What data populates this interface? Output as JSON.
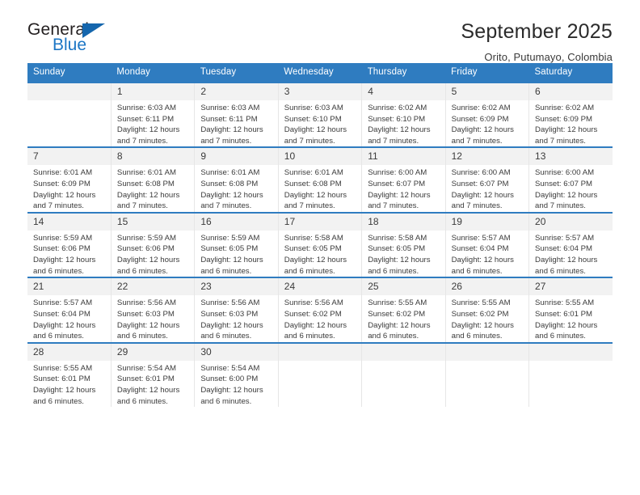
{
  "brand": {
    "name_top": "General",
    "name_bottom": "Blue",
    "triangle_color": "#1566ad",
    "blue_color": "#1c76c5"
  },
  "header": {
    "title": "September 2025",
    "location": "Orito, Putumayo, Colombia"
  },
  "theme": {
    "header_blue": "#2f7cc0",
    "daynum_bg": "#f2f2f2",
    "text": "#3b3b3b"
  },
  "weekday_headers": [
    "Sunday",
    "Monday",
    "Tuesday",
    "Wednesday",
    "Thursday",
    "Friday",
    "Saturday"
  ],
  "calendar": {
    "month": "September",
    "year": "2025",
    "weeks": [
      [
        {
          "day": ""
        },
        {
          "day": "1",
          "sunrise": "Sunrise: 6:03 AM",
          "sunset": "Sunset: 6:11 PM",
          "daylight_1": "Daylight: 12 hours",
          "daylight_2": "and 7 minutes."
        },
        {
          "day": "2",
          "sunrise": "Sunrise: 6:03 AM",
          "sunset": "Sunset: 6:11 PM",
          "daylight_1": "Daylight: 12 hours",
          "daylight_2": "and 7 minutes."
        },
        {
          "day": "3",
          "sunrise": "Sunrise: 6:03 AM",
          "sunset": "Sunset: 6:10 PM",
          "daylight_1": "Daylight: 12 hours",
          "daylight_2": "and 7 minutes."
        },
        {
          "day": "4",
          "sunrise": "Sunrise: 6:02 AM",
          "sunset": "Sunset: 6:10 PM",
          "daylight_1": "Daylight: 12 hours",
          "daylight_2": "and 7 minutes."
        },
        {
          "day": "5",
          "sunrise": "Sunrise: 6:02 AM",
          "sunset": "Sunset: 6:09 PM",
          "daylight_1": "Daylight: 12 hours",
          "daylight_2": "and 7 minutes."
        },
        {
          "day": "6",
          "sunrise": "Sunrise: 6:02 AM",
          "sunset": "Sunset: 6:09 PM",
          "daylight_1": "Daylight: 12 hours",
          "daylight_2": "and 7 minutes."
        }
      ],
      [
        {
          "day": "7",
          "sunrise": "Sunrise: 6:01 AM",
          "sunset": "Sunset: 6:09 PM",
          "daylight_1": "Daylight: 12 hours",
          "daylight_2": "and 7 minutes."
        },
        {
          "day": "8",
          "sunrise": "Sunrise: 6:01 AM",
          "sunset": "Sunset: 6:08 PM",
          "daylight_1": "Daylight: 12 hours",
          "daylight_2": "and 7 minutes."
        },
        {
          "day": "9",
          "sunrise": "Sunrise: 6:01 AM",
          "sunset": "Sunset: 6:08 PM",
          "daylight_1": "Daylight: 12 hours",
          "daylight_2": "and 7 minutes."
        },
        {
          "day": "10",
          "sunrise": "Sunrise: 6:01 AM",
          "sunset": "Sunset: 6:08 PM",
          "daylight_1": "Daylight: 12 hours",
          "daylight_2": "and 7 minutes."
        },
        {
          "day": "11",
          "sunrise": "Sunrise: 6:00 AM",
          "sunset": "Sunset: 6:07 PM",
          "daylight_1": "Daylight: 12 hours",
          "daylight_2": "and 7 minutes."
        },
        {
          "day": "12",
          "sunrise": "Sunrise: 6:00 AM",
          "sunset": "Sunset: 6:07 PM",
          "daylight_1": "Daylight: 12 hours",
          "daylight_2": "and 7 minutes."
        },
        {
          "day": "13",
          "sunrise": "Sunrise: 6:00 AM",
          "sunset": "Sunset: 6:07 PM",
          "daylight_1": "Daylight: 12 hours",
          "daylight_2": "and 7 minutes."
        }
      ],
      [
        {
          "day": "14",
          "sunrise": "Sunrise: 5:59 AM",
          "sunset": "Sunset: 6:06 PM",
          "daylight_1": "Daylight: 12 hours",
          "daylight_2": "and 6 minutes."
        },
        {
          "day": "15",
          "sunrise": "Sunrise: 5:59 AM",
          "sunset": "Sunset: 6:06 PM",
          "daylight_1": "Daylight: 12 hours",
          "daylight_2": "and 6 minutes."
        },
        {
          "day": "16",
          "sunrise": "Sunrise: 5:59 AM",
          "sunset": "Sunset: 6:05 PM",
          "daylight_1": "Daylight: 12 hours",
          "daylight_2": "and 6 minutes."
        },
        {
          "day": "17",
          "sunrise": "Sunrise: 5:58 AM",
          "sunset": "Sunset: 6:05 PM",
          "daylight_1": "Daylight: 12 hours",
          "daylight_2": "and 6 minutes."
        },
        {
          "day": "18",
          "sunrise": "Sunrise: 5:58 AM",
          "sunset": "Sunset: 6:05 PM",
          "daylight_1": "Daylight: 12 hours",
          "daylight_2": "and 6 minutes."
        },
        {
          "day": "19",
          "sunrise": "Sunrise: 5:57 AM",
          "sunset": "Sunset: 6:04 PM",
          "daylight_1": "Daylight: 12 hours",
          "daylight_2": "and 6 minutes."
        },
        {
          "day": "20",
          "sunrise": "Sunrise: 5:57 AM",
          "sunset": "Sunset: 6:04 PM",
          "daylight_1": "Daylight: 12 hours",
          "daylight_2": "and 6 minutes."
        }
      ],
      [
        {
          "day": "21",
          "sunrise": "Sunrise: 5:57 AM",
          "sunset": "Sunset: 6:04 PM",
          "daylight_1": "Daylight: 12 hours",
          "daylight_2": "and 6 minutes."
        },
        {
          "day": "22",
          "sunrise": "Sunrise: 5:56 AM",
          "sunset": "Sunset: 6:03 PM",
          "daylight_1": "Daylight: 12 hours",
          "daylight_2": "and 6 minutes."
        },
        {
          "day": "23",
          "sunrise": "Sunrise: 5:56 AM",
          "sunset": "Sunset: 6:03 PM",
          "daylight_1": "Daylight: 12 hours",
          "daylight_2": "and 6 minutes."
        },
        {
          "day": "24",
          "sunrise": "Sunrise: 5:56 AM",
          "sunset": "Sunset: 6:02 PM",
          "daylight_1": "Daylight: 12 hours",
          "daylight_2": "and 6 minutes."
        },
        {
          "day": "25",
          "sunrise": "Sunrise: 5:55 AM",
          "sunset": "Sunset: 6:02 PM",
          "daylight_1": "Daylight: 12 hours",
          "daylight_2": "and 6 minutes."
        },
        {
          "day": "26",
          "sunrise": "Sunrise: 5:55 AM",
          "sunset": "Sunset: 6:02 PM",
          "daylight_1": "Daylight: 12 hours",
          "daylight_2": "and 6 minutes."
        },
        {
          "day": "27",
          "sunrise": "Sunrise: 5:55 AM",
          "sunset": "Sunset: 6:01 PM",
          "daylight_1": "Daylight: 12 hours",
          "daylight_2": "and 6 minutes."
        }
      ],
      [
        {
          "day": "28",
          "sunrise": "Sunrise: 5:55 AM",
          "sunset": "Sunset: 6:01 PM",
          "daylight_1": "Daylight: 12 hours",
          "daylight_2": "and 6 minutes."
        },
        {
          "day": "29",
          "sunrise": "Sunrise: 5:54 AM",
          "sunset": "Sunset: 6:01 PM",
          "daylight_1": "Daylight: 12 hours",
          "daylight_2": "and 6 minutes."
        },
        {
          "day": "30",
          "sunrise": "Sunrise: 5:54 AM",
          "sunset": "Sunset: 6:00 PM",
          "daylight_1": "Daylight: 12 hours",
          "daylight_2": "and 6 minutes."
        },
        {
          "day": ""
        },
        {
          "day": ""
        },
        {
          "day": ""
        },
        {
          "day": ""
        }
      ]
    ]
  }
}
